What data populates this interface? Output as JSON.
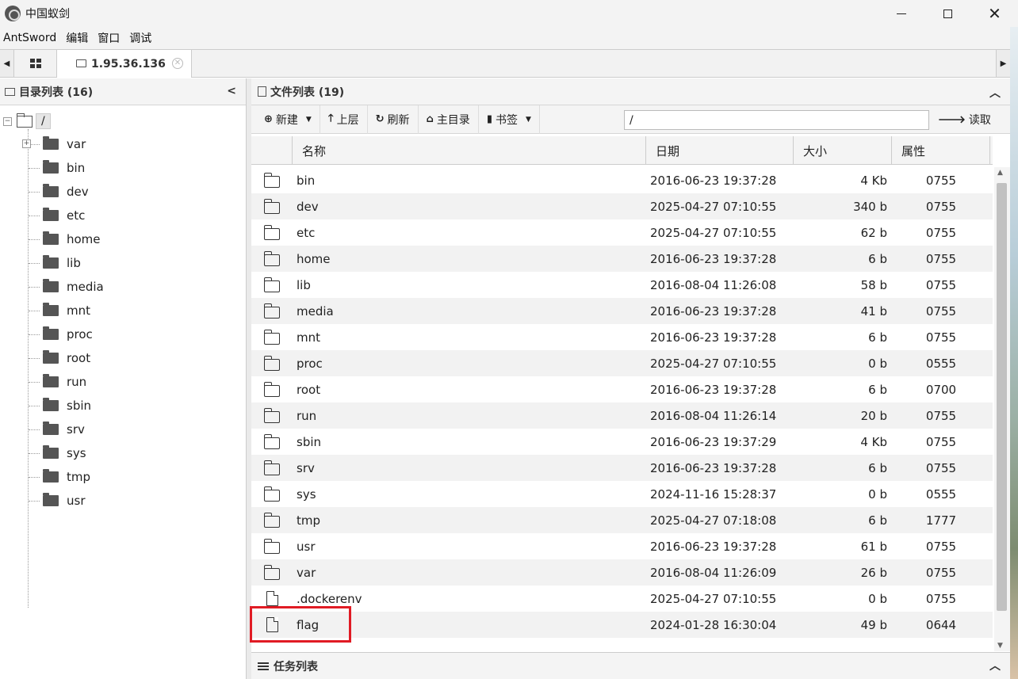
{
  "window": {
    "title": "中国蚁剑"
  },
  "menu": {
    "items": [
      "AntSword",
      "编辑",
      "窗口",
      "调试"
    ]
  },
  "tabs": {
    "host_tab": "1.95.36.136"
  },
  "left_panel": {
    "title": "目录列表 (16)",
    "root": "/",
    "dirs": [
      "var",
      "bin",
      "dev",
      "etc",
      "home",
      "lib",
      "media",
      "mnt",
      "proc",
      "root",
      "run",
      "sbin",
      "srv",
      "sys",
      "tmp",
      "usr"
    ]
  },
  "right_panel": {
    "title": "文件列表 (19)",
    "toolbar": {
      "new": "新建",
      "up": "上层",
      "refresh": "刷新",
      "home": "主目录",
      "bookmark": "书签",
      "path_value": "/",
      "read": "读取"
    },
    "columns": [
      "名称",
      "日期",
      "大小",
      "属性"
    ],
    "files": [
      {
        "type": "folder",
        "name": "bin",
        "date": "2016-06-23 19:37:28",
        "size": "4 Kb",
        "attr": "0755"
      },
      {
        "type": "folder",
        "name": "dev",
        "date": "2025-04-27 07:10:55",
        "size": "340 b",
        "attr": "0755"
      },
      {
        "type": "folder",
        "name": "etc",
        "date": "2025-04-27 07:10:55",
        "size": "62 b",
        "attr": "0755"
      },
      {
        "type": "folder",
        "name": "home",
        "date": "2016-06-23 19:37:28",
        "size": "6 b",
        "attr": "0755"
      },
      {
        "type": "folder",
        "name": "lib",
        "date": "2016-08-04 11:26:08",
        "size": "58 b",
        "attr": "0755"
      },
      {
        "type": "folder",
        "name": "media",
        "date": "2016-06-23 19:37:28",
        "size": "41 b",
        "attr": "0755"
      },
      {
        "type": "folder",
        "name": "mnt",
        "date": "2016-06-23 19:37:28",
        "size": "6 b",
        "attr": "0755"
      },
      {
        "type": "folder",
        "name": "proc",
        "date": "2025-04-27 07:10:55",
        "size": "0 b",
        "attr": "0555"
      },
      {
        "type": "folder",
        "name": "root",
        "date": "2016-06-23 19:37:28",
        "size": "6 b",
        "attr": "0700"
      },
      {
        "type": "folder",
        "name": "run",
        "date": "2016-08-04 11:26:14",
        "size": "20 b",
        "attr": "0755"
      },
      {
        "type": "folder",
        "name": "sbin",
        "date": "2016-06-23 19:37:29",
        "size": "4 Kb",
        "attr": "0755"
      },
      {
        "type": "folder",
        "name": "srv",
        "date": "2016-06-23 19:37:28",
        "size": "6 b",
        "attr": "0755"
      },
      {
        "type": "folder",
        "name": "sys",
        "date": "2024-11-16 15:28:37",
        "size": "0 b",
        "attr": "0555"
      },
      {
        "type": "folder",
        "name": "tmp",
        "date": "2025-04-27 07:18:08",
        "size": "6 b",
        "attr": "1777"
      },
      {
        "type": "folder",
        "name": "usr",
        "date": "2016-06-23 19:37:28",
        "size": "61 b",
        "attr": "0755"
      },
      {
        "type": "folder",
        "name": "var",
        "date": "2016-08-04 11:26:09",
        "size": "26 b",
        "attr": "0755"
      },
      {
        "type": "file",
        "name": ".dockerenv",
        "date": "2025-04-27 07:10:55",
        "size": "0 b",
        "attr": "0755"
      },
      {
        "type": "file",
        "name": "flag",
        "date": "2024-01-28 16:30:04",
        "size": "49 b",
        "attr": "0644"
      }
    ]
  },
  "task_panel": {
    "title": "任务列表"
  },
  "colors": {
    "highlight_border": "#e01b24",
    "header_bg": "#f4f4f4",
    "alt_row_bg": "#f2f2f2"
  }
}
